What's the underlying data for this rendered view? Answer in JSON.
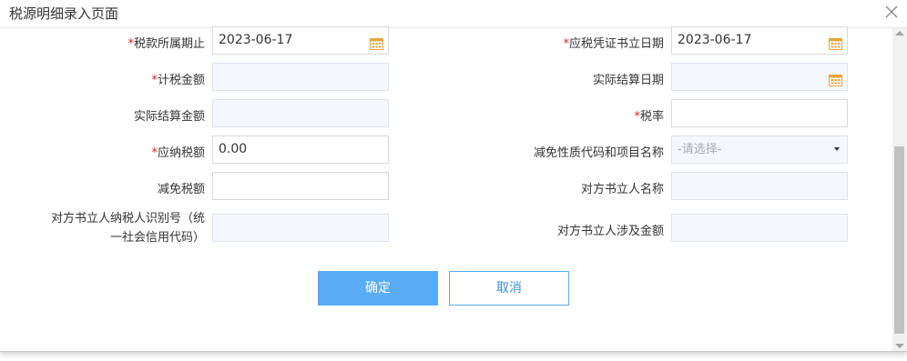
{
  "dialog": {
    "title": "税源明细录入页面"
  },
  "form": {
    "required_mark": "*",
    "left": {
      "tax_period": {
        "label": "税款所属期止",
        "value": "2023-06-17"
      },
      "tax_base_amount": {
        "label": "计税金额",
        "value": ""
      },
      "actual_settlement_amount": {
        "label": "实际结算金额",
        "value": ""
      },
      "tax_payable": {
        "label": "应纳税额",
        "value": "0.00"
      },
      "tax_reduction": {
        "label": "减免税额",
        "value": ""
      },
      "counterparty_tax_id": {
        "label_line1": "对方书立人纳税人识别号（统",
        "label_line2": "一社会信用代码）",
        "value": ""
      }
    },
    "right": {
      "voucher_date": {
        "label": "应税凭证书立日期",
        "value": "2023-06-17"
      },
      "actual_settlement_date": {
        "label": "实际结算日期",
        "value": ""
      },
      "tax_rate": {
        "label": "税率",
        "value": ""
      },
      "reduction_code": {
        "label": "减免性质代码和项目名称",
        "placeholder": "-请选择-"
      },
      "counterparty_name": {
        "label": "对方书立人名称",
        "value": ""
      },
      "counterparty_amount": {
        "label": "对方书立人涉及金额",
        "value": ""
      }
    }
  },
  "buttons": {
    "confirm": "确定",
    "cancel": "取消"
  },
  "icons": {
    "close": "close-icon",
    "calendar": "calendar-icon",
    "dropdown": "chevron-down-icon"
  },
  "colors": {
    "primary": "#5aacf4",
    "required": "#e02020",
    "disabled_field_bg": "#f4f8fd",
    "calendar_icon": "#e8a53a"
  }
}
